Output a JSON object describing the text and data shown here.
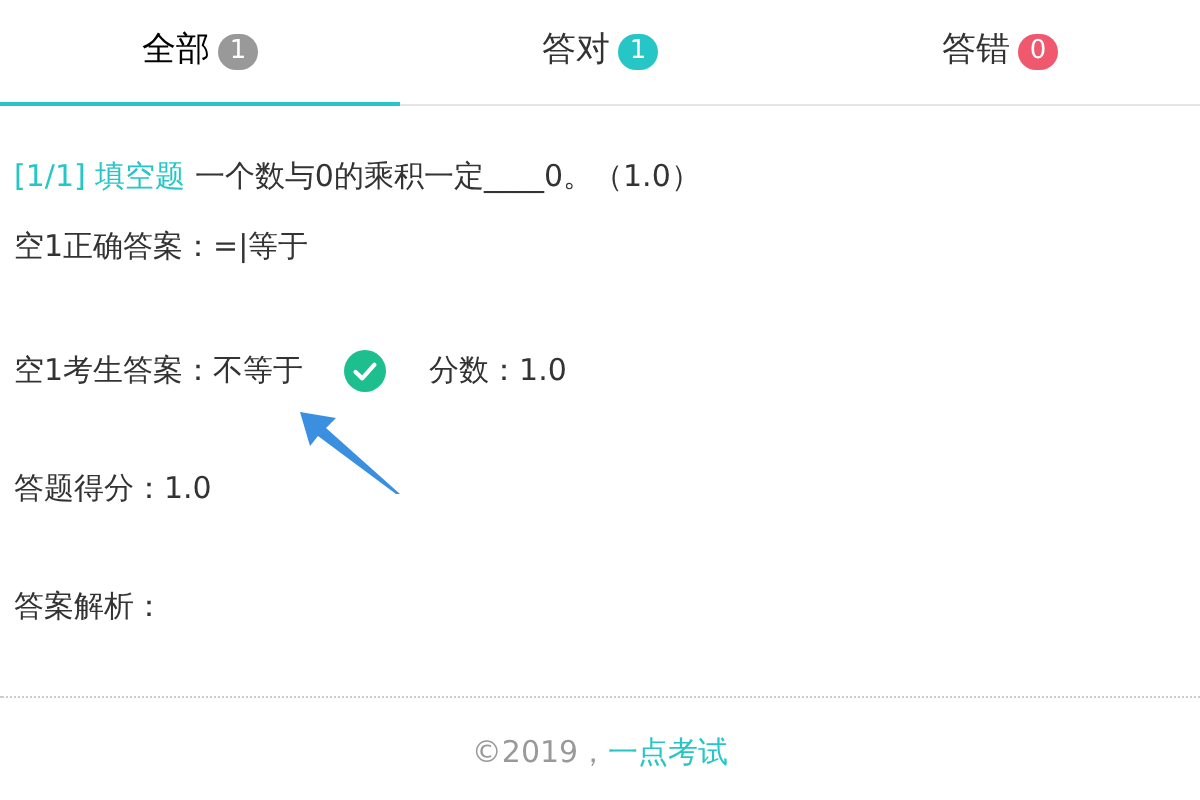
{
  "tabs": [
    {
      "label": "全部",
      "count": "1",
      "color": "#999999",
      "selected": true
    },
    {
      "label": "答对",
      "count": "1",
      "color": "#26c6c6",
      "selected": false
    },
    {
      "label": "答错",
      "count": "0",
      "color": "#f0586e",
      "selected": false
    }
  ],
  "question": {
    "index": "[1/1]",
    "type": "填空题",
    "text": "一个数与0的乘积一定____0。（1.0）"
  },
  "correct_answer": "空1正确答案：=|等于",
  "student_answer": {
    "label": "空1考生答案：不等于",
    "correct": true,
    "score": "分数：1.0"
  },
  "total_score": "答题得分：1.0",
  "analysis": "答案解析：",
  "footer": {
    "copyright": "©2019，",
    "link": "一点考试"
  }
}
